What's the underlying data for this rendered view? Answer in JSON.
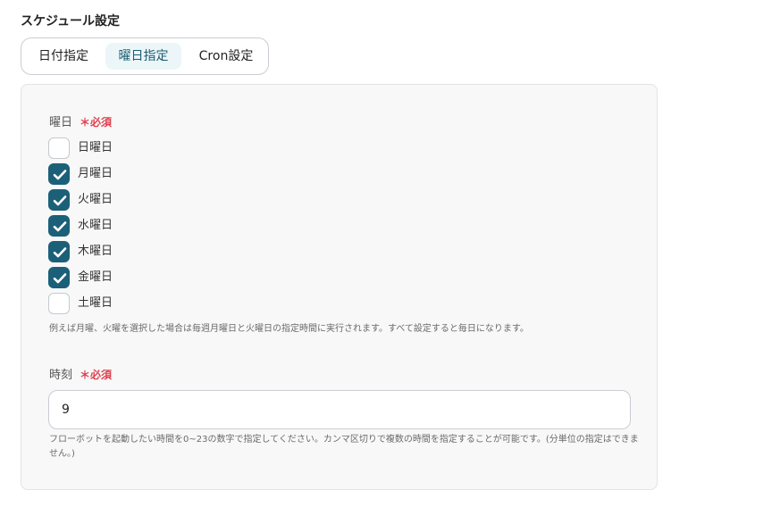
{
  "section_title": "スケジュール設定",
  "tabs": [
    {
      "label": "日付指定",
      "active": false
    },
    {
      "label": "曜日指定",
      "active": true
    },
    {
      "label": "Cron設定",
      "active": false
    }
  ],
  "weekday_field": {
    "label": "曜日",
    "required_label": "＊必須",
    "days": [
      {
        "label": "日曜日",
        "checked": false
      },
      {
        "label": "月曜日",
        "checked": true
      },
      {
        "label": "火曜日",
        "checked": true
      },
      {
        "label": "水曜日",
        "checked": true
      },
      {
        "label": "木曜日",
        "checked": true
      },
      {
        "label": "金曜日",
        "checked": true
      },
      {
        "label": "土曜日",
        "checked": false
      }
    ],
    "helper": "例えば月曜、火曜を選択した場合は毎週月曜日と火曜日の指定時間に実行されます。すべて設定すると毎日になります。"
  },
  "time_field": {
    "label": "時刻",
    "required_label": "＊必須",
    "value": "9",
    "helper": "フローボットを起動したい時間を0~23の数字で指定してください。カンマ区切りで複数の時間を指定することが可能です。(分単位の指定はできません。)"
  },
  "colors": {
    "accent": "#1b6078",
    "active_tab_bg": "#ecf6f8",
    "required": "#e0404f",
    "panel_bg": "#f8f8f8"
  }
}
